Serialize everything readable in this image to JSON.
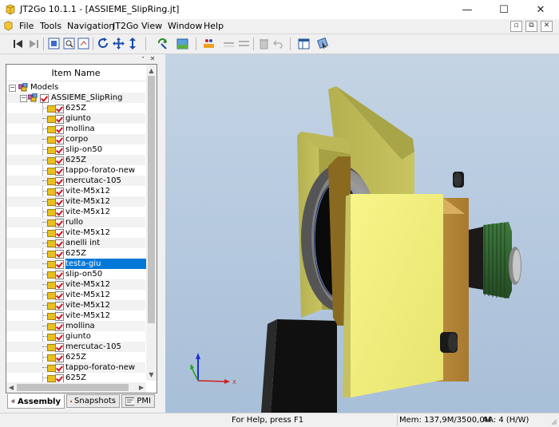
{
  "window": {
    "title": "JT2Go 10.1.1 - [ASSIEME_SlipRing.jt]",
    "minimize_glyph": "—",
    "maximize_glyph": "☐",
    "close_glyph": "✕"
  },
  "menu": {
    "items": [
      "File",
      "Tools",
      "Navigation",
      "JT2Go",
      "View",
      "Window",
      "Help"
    ]
  },
  "mdi": {
    "restore": "▫",
    "pin": "⧉",
    "close": "✕"
  },
  "panel": {
    "pin_glyph": "ᐩ",
    "close_glyph": "✕",
    "column_header": "Item Name",
    "scroll_up": "▲",
    "scroll_down": "▼",
    "scroll_left": "◀",
    "scroll_right": "▶"
  },
  "tree": {
    "root": "Models",
    "assembly": "ASSIEME_SlipRing",
    "items": [
      "625Z",
      "giunto",
      "mollina",
      "corpo",
      "slip-on50",
      "625Z",
      "tappo-forato-new",
      "mercutac-105",
      "vite-M5x12",
      "vite-M5x12",
      "vite-M5x12",
      "rullo",
      "vite-M5x12",
      "anelli int",
      "625Z",
      "testa-giu",
      "slip-on50",
      "vite-M5x12",
      "vite-M5x12",
      "vite-M5x12",
      "vite-M5x12",
      "mollina",
      "giunto",
      "mercutac-105",
      "625Z",
      "tappo-forato-new",
      "625Z"
    ],
    "selected_index": 15
  },
  "tabs": [
    {
      "label": "Assembly",
      "active": true
    },
    {
      "label": "Snapshots",
      "active": false
    },
    {
      "label": "PMI",
      "active": false
    }
  ],
  "status": {
    "help": "For Help, press F1",
    "memory": "Mem: 137,9M/3500,0M",
    "aa": "AA: 4 (H/W)"
  },
  "colors": {
    "selection": "#0078d7",
    "block_face": "#f4f07a",
    "block_side": "#b8b450",
    "bronze": "#c8a050",
    "green_part": "#3a6a3a"
  }
}
